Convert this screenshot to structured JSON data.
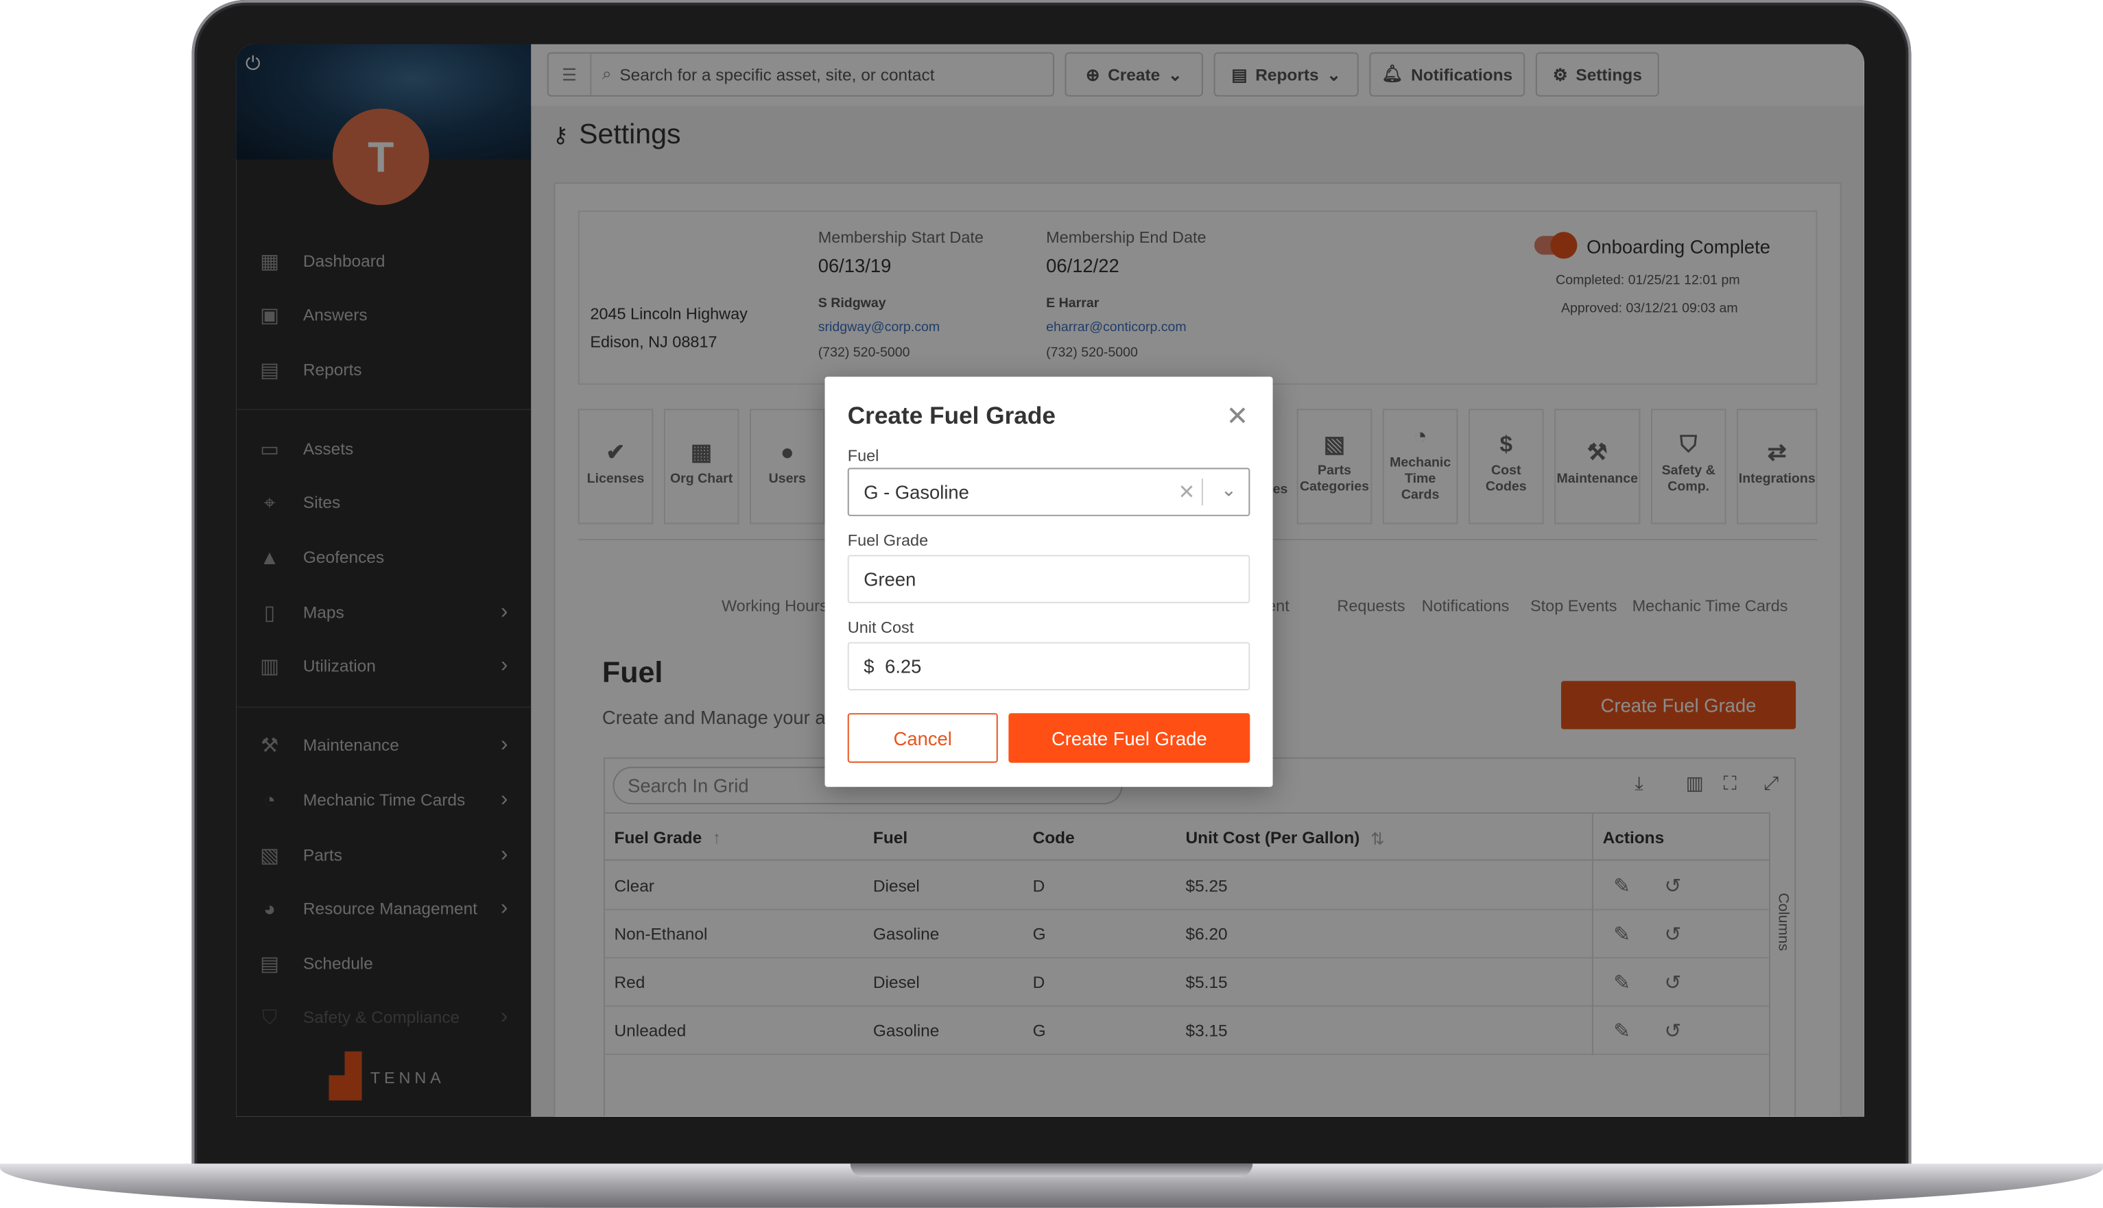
{
  "sidebar": {
    "avatar_initial": "T",
    "items": [
      {
        "icon": "dashboard-icon",
        "label": "Dashboard",
        "has_chevron": false
      },
      {
        "icon": "answers-icon",
        "label": "Answers",
        "has_chevron": false
      },
      {
        "icon": "reports-icon",
        "label": "Reports",
        "has_chevron": false
      },
      {
        "icon": "assets-icon",
        "label": "Assets",
        "has_chevron": false
      },
      {
        "icon": "sites-pin-icon",
        "label": "Sites",
        "has_chevron": false
      },
      {
        "icon": "geofences-icon",
        "label": "Geofences",
        "has_chevron": false
      },
      {
        "icon": "maps-icon",
        "label": "Maps",
        "has_chevron": true
      },
      {
        "icon": "utilization-icon",
        "label": "Utilization",
        "has_chevron": true
      },
      {
        "icon": "wrench-icon",
        "label": "Maintenance",
        "has_chevron": true
      },
      {
        "icon": "clock-icon",
        "label": "Mechanic Time Cards",
        "has_chevron": true
      },
      {
        "icon": "parts-icon",
        "label": "Parts",
        "has_chevron": true
      },
      {
        "icon": "pie-icon",
        "label": "Resource Management",
        "has_chevron": true
      },
      {
        "icon": "calendar-icon",
        "label": "Schedule",
        "has_chevron": false
      },
      {
        "icon": "shield-icon",
        "label": "Safety & Compliance",
        "has_chevron": true
      }
    ],
    "brand": "TENNA"
  },
  "topbar": {
    "search_placeholder": "Search for a specific asset, site, or contact",
    "create_label": "Create",
    "reports_label": "Reports",
    "notifications_label": "Notifications",
    "settings_label": "Settings"
  },
  "page_title": "Settings",
  "org": {
    "address_line1": "2045 Lincoln Highway",
    "address_line2": "Edison, NJ 08817",
    "start_label": "Membership Start Date",
    "start_date": "06/13/19",
    "start_name": "S Ridgway",
    "start_email": "sridgway@corp.com",
    "start_phone": "(732) 520-5000",
    "end_label": "Membership End Date",
    "end_date": "06/12/22",
    "end_name": "E Harrar",
    "end_email": "eharrar@conticorp.com",
    "end_phone": "(732) 520-5000",
    "onboarding_label": "Onboarding Complete",
    "completed": "Completed: 01/25/21 12:01 pm",
    "approved": "Approved: 03/12/21 09:03 am"
  },
  "tiles": [
    {
      "icon": "clipboard-check-icon",
      "label": "Licenses"
    },
    {
      "icon": "org-chart-icon",
      "label": "Org Chart"
    },
    {
      "icon": "user-icon",
      "label": "Users"
    },
    {
      "icon": "parts-categories-icon",
      "label": "Parts Categories"
    },
    {
      "icon": "mechanic-clock-icon",
      "label": "Mechanic Time Cards"
    },
    {
      "icon": "dollar-icon",
      "label": "Cost Codes"
    },
    {
      "icon": "wrench-icon",
      "label": "Maintenance"
    },
    {
      "icon": "shield-check-icon",
      "label": "Safety & Comp."
    },
    {
      "icon": "swap-arrows-icon",
      "label": "Integrations"
    }
  ],
  "tile_partial_label": "es",
  "subtabs": [
    "Working Hours",
    "ement",
    "Requests",
    "Notifications",
    "Stop Events",
    "Mechanic Time Cards"
  ],
  "fuel": {
    "title": "Fuel",
    "subtitle": "Create and Manage your ac",
    "create_button": "Create Fuel Grade",
    "grid_search_placeholder": "Search In Grid",
    "columns_tab": "Columns",
    "headers": [
      "Fuel Grade",
      "Fuel",
      "Code",
      "Unit Cost (Per Gallon)",
      "Actions"
    ],
    "rows": [
      {
        "grade": "Clear",
        "fuel": "Diesel",
        "code": "D",
        "cost": "$5.25"
      },
      {
        "grade": "Non-Ethanol",
        "fuel": "Gasoline",
        "code": "G",
        "cost": "$6.20"
      },
      {
        "grade": "Red",
        "fuel": "Diesel",
        "code": "D",
        "cost": "$5.15"
      },
      {
        "grade": "Unleaded",
        "fuel": "Gasoline",
        "code": "G",
        "cost": "$3.15"
      }
    ]
  },
  "modal": {
    "title": "Create Fuel Grade",
    "fuel_label": "Fuel",
    "fuel_value": "G - Gasoline",
    "grade_label": "Fuel Grade",
    "grade_value": "Green",
    "cost_label": "Unit Cost",
    "cost_prefix": "$",
    "cost_value": "6.25",
    "cancel_label": "Cancel",
    "create_label": "Create Fuel Grade"
  },
  "colors": {
    "accent": "#e6541c",
    "sidebar_bg": "#2d2d2d",
    "avatar": "#e3734b"
  }
}
